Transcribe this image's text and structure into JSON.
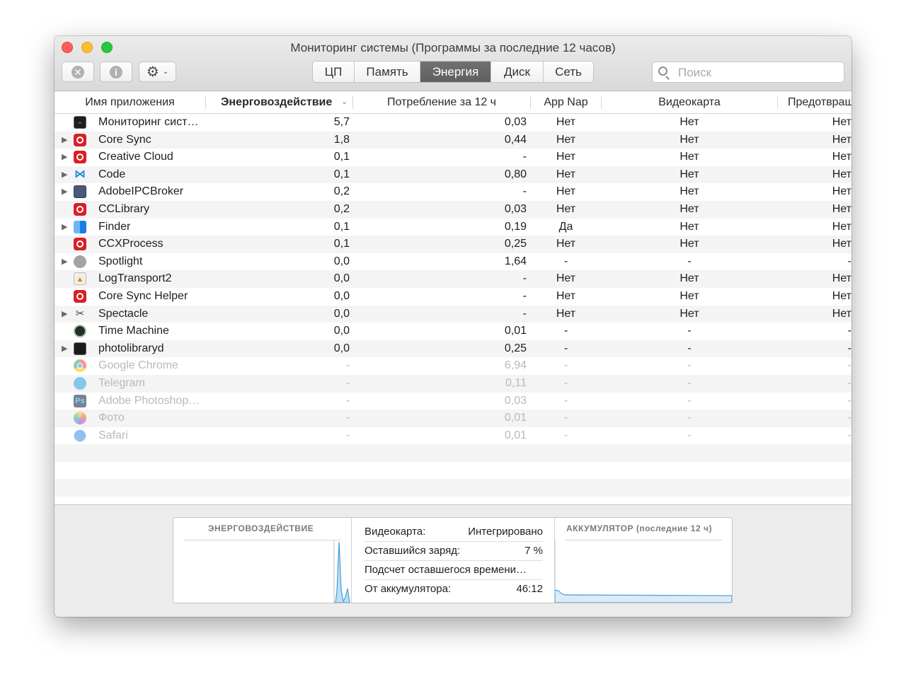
{
  "window": {
    "title": "Мониторинг системы (Программы за последние 12 часов)"
  },
  "toolbar": {
    "stop_icon": "x-circle-icon",
    "info_icon": "info-circle-icon",
    "gear_icon": "gear-icon",
    "stop_glyph": "✕",
    "info_glyph": "i",
    "gear_glyph": "⚙",
    "chevron_glyph": "⌄"
  },
  "tabs": [
    {
      "label": "ЦП",
      "active": false
    },
    {
      "label": "Память",
      "active": false
    },
    {
      "label": "Энергия",
      "active": true
    },
    {
      "label": "Диск",
      "active": false
    },
    {
      "label": "Сеть",
      "active": false
    }
  ],
  "search": {
    "placeholder": "Поиск",
    "value": ""
  },
  "table": {
    "columns": [
      "Имя приложения",
      "Энерговоздействие",
      "Потребление за 12 ч",
      "App Nap",
      "Видеокарта",
      "Предотвращ"
    ],
    "sorted_column": 1,
    "rows": [
      {
        "name": "Мониторинг сист…",
        "icon": "activity-monitor-icon",
        "expand": false,
        "dim": false,
        "impact": "5,7",
        "usage": "0,03",
        "appnap": "Нет",
        "gpu": "Нет",
        "prevent": "Нет"
      },
      {
        "name": "Core Sync",
        "icon": "creative-cloud-icon",
        "expand": true,
        "dim": false,
        "impact": "1,8",
        "usage": "0,44",
        "appnap": "Нет",
        "gpu": "Нет",
        "prevent": "Нет"
      },
      {
        "name": "Creative Cloud",
        "icon": "creative-cloud-icon",
        "expand": true,
        "dim": false,
        "impact": "0,1",
        "usage": "-",
        "appnap": "Нет",
        "gpu": "Нет",
        "prevent": "Нет"
      },
      {
        "name": "Code",
        "icon": "vscode-icon",
        "expand": true,
        "dim": false,
        "impact": "0,1",
        "usage": "0,80",
        "appnap": "Нет",
        "gpu": "Нет",
        "prevent": "Нет"
      },
      {
        "name": "AdobeIPCBroker",
        "icon": "adobe-ipc-broker-icon",
        "expand": true,
        "dim": false,
        "impact": "0,2",
        "usage": "-",
        "appnap": "Нет",
        "gpu": "Нет",
        "prevent": "Нет"
      },
      {
        "name": "CCLibrary",
        "icon": "creative-cloud-icon",
        "expand": false,
        "dim": false,
        "impact": "0,2",
        "usage": "0,03",
        "appnap": "Нет",
        "gpu": "Нет",
        "prevent": "Нет"
      },
      {
        "name": "Finder",
        "icon": "finder-icon",
        "expand": true,
        "dim": false,
        "impact": "0,1",
        "usage": "0,19",
        "appnap": "Да",
        "gpu": "Нет",
        "prevent": "Нет"
      },
      {
        "name": "CCXProcess",
        "icon": "creative-cloud-icon",
        "expand": false,
        "dim": false,
        "impact": "0,1",
        "usage": "0,25",
        "appnap": "Нет",
        "gpu": "Нет",
        "prevent": "Нет"
      },
      {
        "name": "Spotlight",
        "icon": "spotlight-icon",
        "expand": true,
        "dim": false,
        "impact": "0,0",
        "usage": "1,64",
        "appnap": "-",
        "gpu": "-",
        "prevent": "-"
      },
      {
        "name": "LogTransport2",
        "icon": "log-transport-icon",
        "expand": false,
        "dim": false,
        "impact": "0,0",
        "usage": "-",
        "appnap": "Нет",
        "gpu": "Нет",
        "prevent": "Нет"
      },
      {
        "name": "Core Sync Helper",
        "icon": "creative-cloud-icon",
        "expand": false,
        "dim": false,
        "impact": "0,0",
        "usage": "-",
        "appnap": "Нет",
        "gpu": "Нет",
        "prevent": "Нет"
      },
      {
        "name": "Spectacle",
        "icon": "spectacle-icon",
        "expand": true,
        "dim": false,
        "impact": "0,0",
        "usage": "-",
        "appnap": "Нет",
        "gpu": "Нет",
        "prevent": "Нет"
      },
      {
        "name": "Time Machine",
        "icon": "time-machine-icon",
        "expand": false,
        "dim": false,
        "impact": "0,0",
        "usage": "0,01",
        "appnap": "-",
        "gpu": "-",
        "prevent": "-"
      },
      {
        "name": "photolibraryd",
        "icon": "terminal-icon",
        "expand": true,
        "dim": false,
        "impact": "0,0",
        "usage": "0,25",
        "appnap": "-",
        "gpu": "-",
        "prevent": "-"
      },
      {
        "name": "Google Chrome",
        "icon": "chrome-icon",
        "expand": false,
        "dim": true,
        "impact": "-",
        "usage": "6,94",
        "appnap": "-",
        "gpu": "-",
        "prevent": "-"
      },
      {
        "name": "Telegram",
        "icon": "telegram-icon",
        "expand": false,
        "dim": true,
        "impact": "-",
        "usage": "0,11",
        "appnap": "-",
        "gpu": "-",
        "prevent": "-"
      },
      {
        "name": "Adobe Photoshop…",
        "icon": "photoshop-icon",
        "expand": false,
        "dim": true,
        "impact": "-",
        "usage": "0,03",
        "appnap": "-",
        "gpu": "-",
        "prevent": "-"
      },
      {
        "name": "Фото",
        "icon": "photos-icon",
        "expand": false,
        "dim": true,
        "impact": "-",
        "usage": "0,01",
        "appnap": "-",
        "gpu": "-",
        "prevent": "-"
      },
      {
        "name": "Safari",
        "icon": "safari-icon",
        "expand": false,
        "dim": true,
        "impact": "-",
        "usage": "0,01",
        "appnap": "-",
        "gpu": "-",
        "prevent": "-"
      }
    ]
  },
  "bottom": {
    "energy_title": "ЭНЕРГОВОЗДЕЙСТВИЕ",
    "battery_title": "АККУМУЛЯТОР (последние 12 ч)",
    "info": [
      {
        "label": "Видеокарта:",
        "value": "Интегрировано"
      },
      {
        "label": "Оставшийся заряд:",
        "value": "7 %"
      },
      {
        "label": "Подсчет оставшегося времени…",
        "value": ""
      },
      {
        "label": "От аккумулятора:",
        "value": "46:12"
      }
    ],
    "graph_color": "#3ea0dd",
    "graph_fill": "#bfe0f4"
  }
}
